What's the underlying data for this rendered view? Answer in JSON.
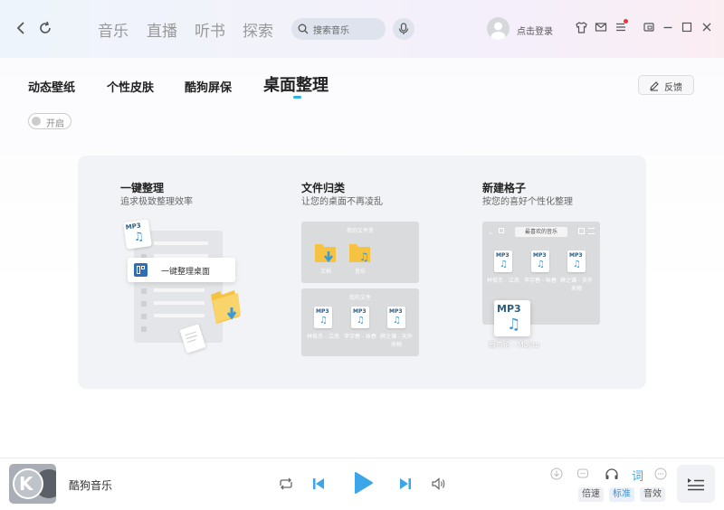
{
  "nav": {
    "tabs": [
      {
        "label": "音乐"
      },
      {
        "label": "直播"
      },
      {
        "label": "听书"
      },
      {
        "label": "探索"
      }
    ],
    "search_placeholder": "搜索音乐",
    "login_label": "点击登录"
  },
  "subtabs": [
    {
      "label": "动态壁纸"
    },
    {
      "label": "个性皮肤"
    },
    {
      "label": "酷狗屏保"
    },
    {
      "label": "桌面整理",
      "active": true
    }
  ],
  "feedback_label": "反馈",
  "toggle_label": "开启",
  "features": {
    "one_click": {
      "title": "一键整理",
      "subtitle": "追求极致整理效率",
      "card_label": "一键整理桌面",
      "file_badge": "MP3"
    },
    "file_classify": {
      "title": "文件归类",
      "subtitle": "让您的桌面不再凌乱",
      "folder_box_title": "我的文件夹",
      "folders": [
        {
          "label": "文档"
        },
        {
          "label": "音乐"
        }
      ],
      "files_box_title": "我的文件",
      "files": [
        {
          "badge": "MP3",
          "label": "林俊杰 - 江南"
        },
        {
          "badge": "MP3",
          "label": "李宇春 - 咏春"
        },
        {
          "badge": "MP3",
          "label": "薛之谦 - 天外来物"
        }
      ]
    },
    "new_grid": {
      "title": "新建格子",
      "subtitle": "按您的喜好个性化整理",
      "grid_title": "最喜欢的音乐",
      "files": [
        {
          "badge": "MP3",
          "label": "林俊杰 - 江南"
        },
        {
          "badge": "MP3",
          "label": "李宇春 - 咏春"
        },
        {
          "badge": "MP3",
          "label": "薛之谦 - 天外来物"
        }
      ],
      "drag_file": {
        "badge": "MP3",
        "label": "周杰伦 - Mojito"
      }
    }
  },
  "player": {
    "song_title": "酷狗音乐",
    "lyric_label": "词",
    "speed_label": "倍速",
    "quality_label": "标准",
    "effect_label": "音效"
  },
  "colors": {
    "accent": "#2eb3e8",
    "play_blue": "#3ca6e8",
    "panel_bg": "#f2f3f6",
    "folder_yellow": "#f5c242"
  }
}
